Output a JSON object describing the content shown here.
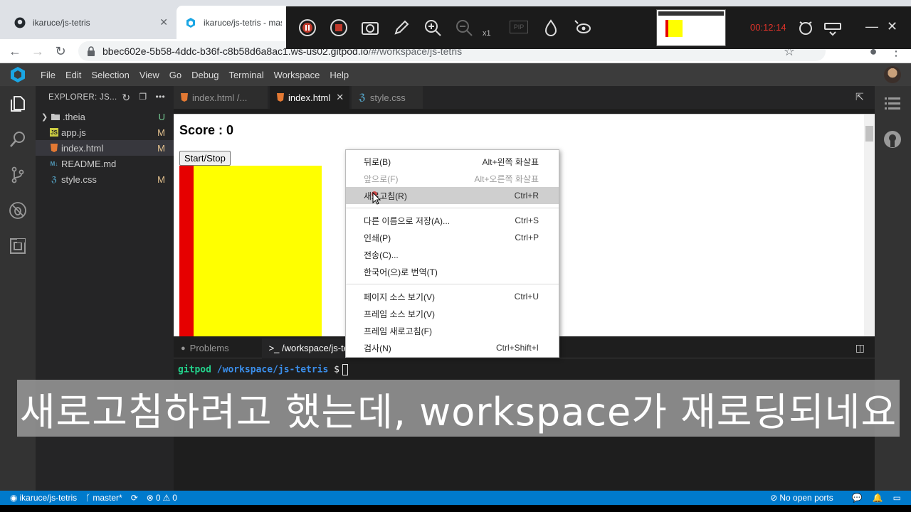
{
  "browser": {
    "tabs": [
      {
        "title": "ikaruce/js-tetris",
        "close": "✕"
      },
      {
        "title": "ikaruce/js-tetris - mas",
        "close": "✕"
      }
    ],
    "url_main": "bbec602e-5b58-4ddc-b36f-c8b58d6a8ac1.ws-us02.gitpod.io",
    "url_rest": "/#/workspace/js-tetris"
  },
  "recorder": {
    "zoom_label": "x1",
    "pip_label": "PIP",
    "time": "00:12:14",
    "time_color": "#e0332a"
  },
  "menubar": [
    "File",
    "Edit",
    "Selection",
    "View",
    "Go",
    "Debug",
    "Terminal",
    "Workspace",
    "Help"
  ],
  "explorer": {
    "title": "EXPLORER: JS...",
    "files": [
      {
        "name": ".theia",
        "status": "U",
        "kind": "folder"
      },
      {
        "name": "app.js",
        "status": "M",
        "kind": "js"
      },
      {
        "name": "index.html",
        "status": "M",
        "kind": "html"
      },
      {
        "name": "README.md",
        "status": "",
        "kind": "md"
      },
      {
        "name": "style.css",
        "status": "M",
        "kind": "css"
      }
    ]
  },
  "editor_tabs": [
    {
      "label": "index.html /...",
      "close": ""
    },
    {
      "label": "index.html",
      "close": "✕"
    },
    {
      "label": "style.css",
      "close": ""
    }
  ],
  "preview": {
    "score": "Score : 0",
    "button": "Start/Stop"
  },
  "context_menu": {
    "group1": [
      {
        "label": "뒤로(B)",
        "shortcut": "Alt+왼쪽 화살표",
        "disabled": false
      },
      {
        "label": "앞으로(F)",
        "shortcut": "Alt+오른쪽 화살표",
        "disabled": true
      },
      {
        "label": "새로고침(R)",
        "shortcut": "Ctrl+R",
        "disabled": false
      }
    ],
    "group2": [
      {
        "label": "다른 이름으로 저장(A)...",
        "shortcut": "Ctrl+S"
      },
      {
        "label": "인쇄(P)",
        "shortcut": "Ctrl+P"
      },
      {
        "label": "전송(C)...",
        "shortcut": ""
      },
      {
        "label": "한국어(으)로 번역(T)",
        "shortcut": ""
      }
    ],
    "group3": [
      {
        "label": "페이지 소스 보기(V)",
        "shortcut": "Ctrl+U"
      },
      {
        "label": "프레임 소스 보기(V)",
        "shortcut": ""
      },
      {
        "label": "프레임 새로고침(F)",
        "shortcut": ""
      },
      {
        "label": "검사(N)",
        "shortcut": "Ctrl+Shift+I"
      }
    ]
  },
  "panel": {
    "tabs": [
      "Problems",
      ">_ /workspace/js-tetri"
    ],
    "prompt_user": "gitpod",
    "prompt_path": "/workspace/js-tetris",
    "prompt_symbol": "$"
  },
  "subtitle": "새로고침하려고 했는데, workspace가 재로딩되네요",
  "statusbar": {
    "repo": "ikaruce/js-tetris",
    "branch": "master*",
    "errors": "0",
    "warnings": "0",
    "ports": "No open ports"
  }
}
